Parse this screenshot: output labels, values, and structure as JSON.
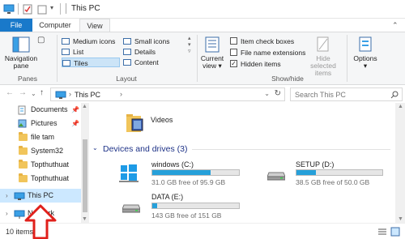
{
  "window": {
    "title": "This PC"
  },
  "ribbon_tabs": {
    "file": "File",
    "computer": "Computer",
    "view": "View"
  },
  "panes": {
    "navigation_pane": "Navigation pane",
    "group_label": "Panes"
  },
  "layout": {
    "group_label": "Layout",
    "items": {
      "medium_icons": "Medium icons",
      "small_icons": "Small icons",
      "list": "List",
      "details": "Details",
      "tiles": "Tiles",
      "content": "Content"
    },
    "selected": "Tiles"
  },
  "current_view": {
    "label_line1": "Current",
    "label_line2": "view"
  },
  "show_hide": {
    "group_label": "Show/hide",
    "item_check_boxes": {
      "label": "Item check boxes",
      "checked": false
    },
    "file_name_extensions": {
      "label": "File name extensions",
      "checked": false
    },
    "hidden_items": {
      "label": "Hidden items",
      "checked": true
    },
    "hide_selected": {
      "line1": "Hide selected",
      "line2": "items"
    },
    "check_mark": "✓"
  },
  "options": {
    "label": "Options"
  },
  "address": {
    "path": "This PC",
    "separator": "›"
  },
  "search": {
    "placeholder": "Search This PC"
  },
  "nav": {
    "items": [
      {
        "label": "Documents",
        "pinned": true
      },
      {
        "label": "Pictures",
        "pinned": true
      },
      {
        "label": "file tam"
      },
      {
        "label": "System32"
      },
      {
        "label": "Topthuthuat"
      },
      {
        "label": "Topthuthuat"
      }
    ],
    "this_pc": "This PC",
    "network": "Network"
  },
  "content": {
    "videos_label": "Videos",
    "section_header": "Devices and drives (3)",
    "drives": [
      {
        "name": "windows (C:)",
        "free_text": "31.0 GB free of 95.9 GB",
        "used_fraction": 0.677
      },
      {
        "name": "SETUP (D:)",
        "free_text": "38.5 GB free of 50.0 GB",
        "used_fraction": 0.23
      },
      {
        "name": "DATA (E:)",
        "free_text": "143 GB free of 151 GB",
        "used_fraction": 0.053
      }
    ]
  },
  "status": {
    "item_count": "10 items"
  },
  "colors": {
    "accent": "#1979ca",
    "drive_fill": "#26a0da",
    "annotation_arrow": "#e0201b"
  }
}
